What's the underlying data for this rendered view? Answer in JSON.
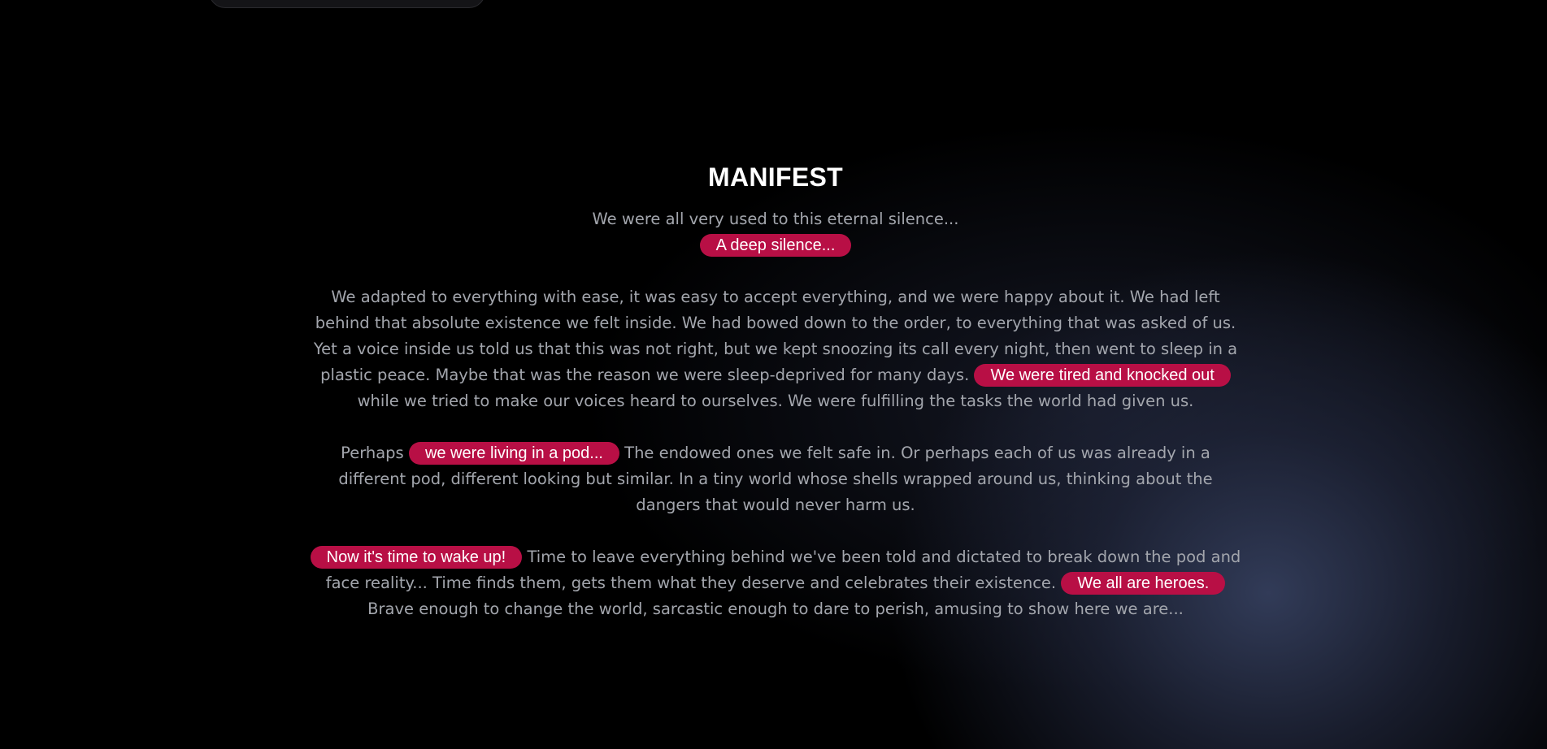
{
  "manifest": {
    "title": "MANIFEST",
    "intro": "We were all very used to this eternal silence...",
    "intro_highlight": "A deep silence...",
    "p1": {
      "text": "We adapted to everything with ease, it was easy to accept everything, and we were happy about it. We had left behind that absolute existence we felt inside. We had bowed down to the order, to everything that was asked of us. Yet a voice inside us told us that this was not right, but we kept snoozing its call every night, then went to sleep in a plastic peace. Maybe that was the reason we were sleep-deprived for many days.",
      "highlight": "We were tired and knocked out",
      "after": "while we tried to make our voices heard to ourselves. We were fulfilling the tasks the world had given us."
    },
    "p2": {
      "before": "Perhaps",
      "highlight": "we were living in a pod...",
      "after": "The endowed ones we felt safe in. Or perhaps each of us was already in a different pod, different looking but similar. In a tiny world whose shells wrapped around us, thinking about the dangers that would never harm us."
    },
    "p3": {
      "highlight": "Now it's time to wake up!",
      "middle": "Time to leave everything behind we've been told and dictated to break down the pod and face reality... Time finds them, gets them what they deserve and celebrates their existence.",
      "highlight2": "We all are heroes.",
      "after": "Brave enough to change the world, sarcastic enough to dare to perish, amusing to show here we are..."
    }
  },
  "colors": {
    "background": "#000000",
    "glow": "#343e5c",
    "highlight_bg": "#b80f45",
    "highlight_text": "#ffffff",
    "body_text": "#a3a6ad",
    "title_text": "#ffffff"
  }
}
